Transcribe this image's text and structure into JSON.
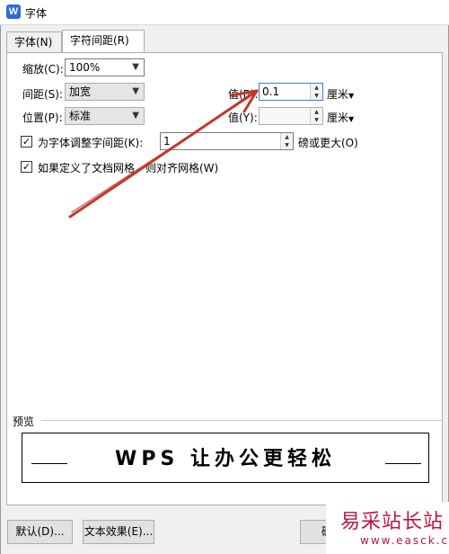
{
  "window": {
    "title": "字体",
    "app_icon": "W"
  },
  "tabs": [
    {
      "label": "字体(N)",
      "active": false
    },
    {
      "label": "字符间距(R)",
      "active": true
    }
  ],
  "spacing": {
    "scale_label": "缩放(C):",
    "scale_value": "100%",
    "spacing_label": "间距(S):",
    "spacing_value": "加宽",
    "position_label": "位置(P):",
    "position_value": "标准",
    "by1_label": "值(B):",
    "by1_value": "0.1",
    "by1_unit": "厘米",
    "by2_label": "值(Y):",
    "by2_value": "",
    "by2_unit": "厘米"
  },
  "kerning": {
    "label": "为字体调整字间距(K):",
    "value": "1",
    "suffix": "磅或更大(O)",
    "checked": true
  },
  "grid": {
    "label": "如果定义了文档网格，则对齐网格(W)",
    "checked": true
  },
  "preview": {
    "label": "预览",
    "text": "WPS 让办公更轻松"
  },
  "buttons": {
    "default_label": "默认(D)...",
    "effects_label": "文本效果(E)...",
    "ok_label": "确"
  },
  "watermark": {
    "big": "易采站长站",
    "small": "www.easck.com"
  },
  "colors": {
    "arrow": "#c0392b",
    "watermark": "#c0143c",
    "brand": "#2f6bd6"
  }
}
